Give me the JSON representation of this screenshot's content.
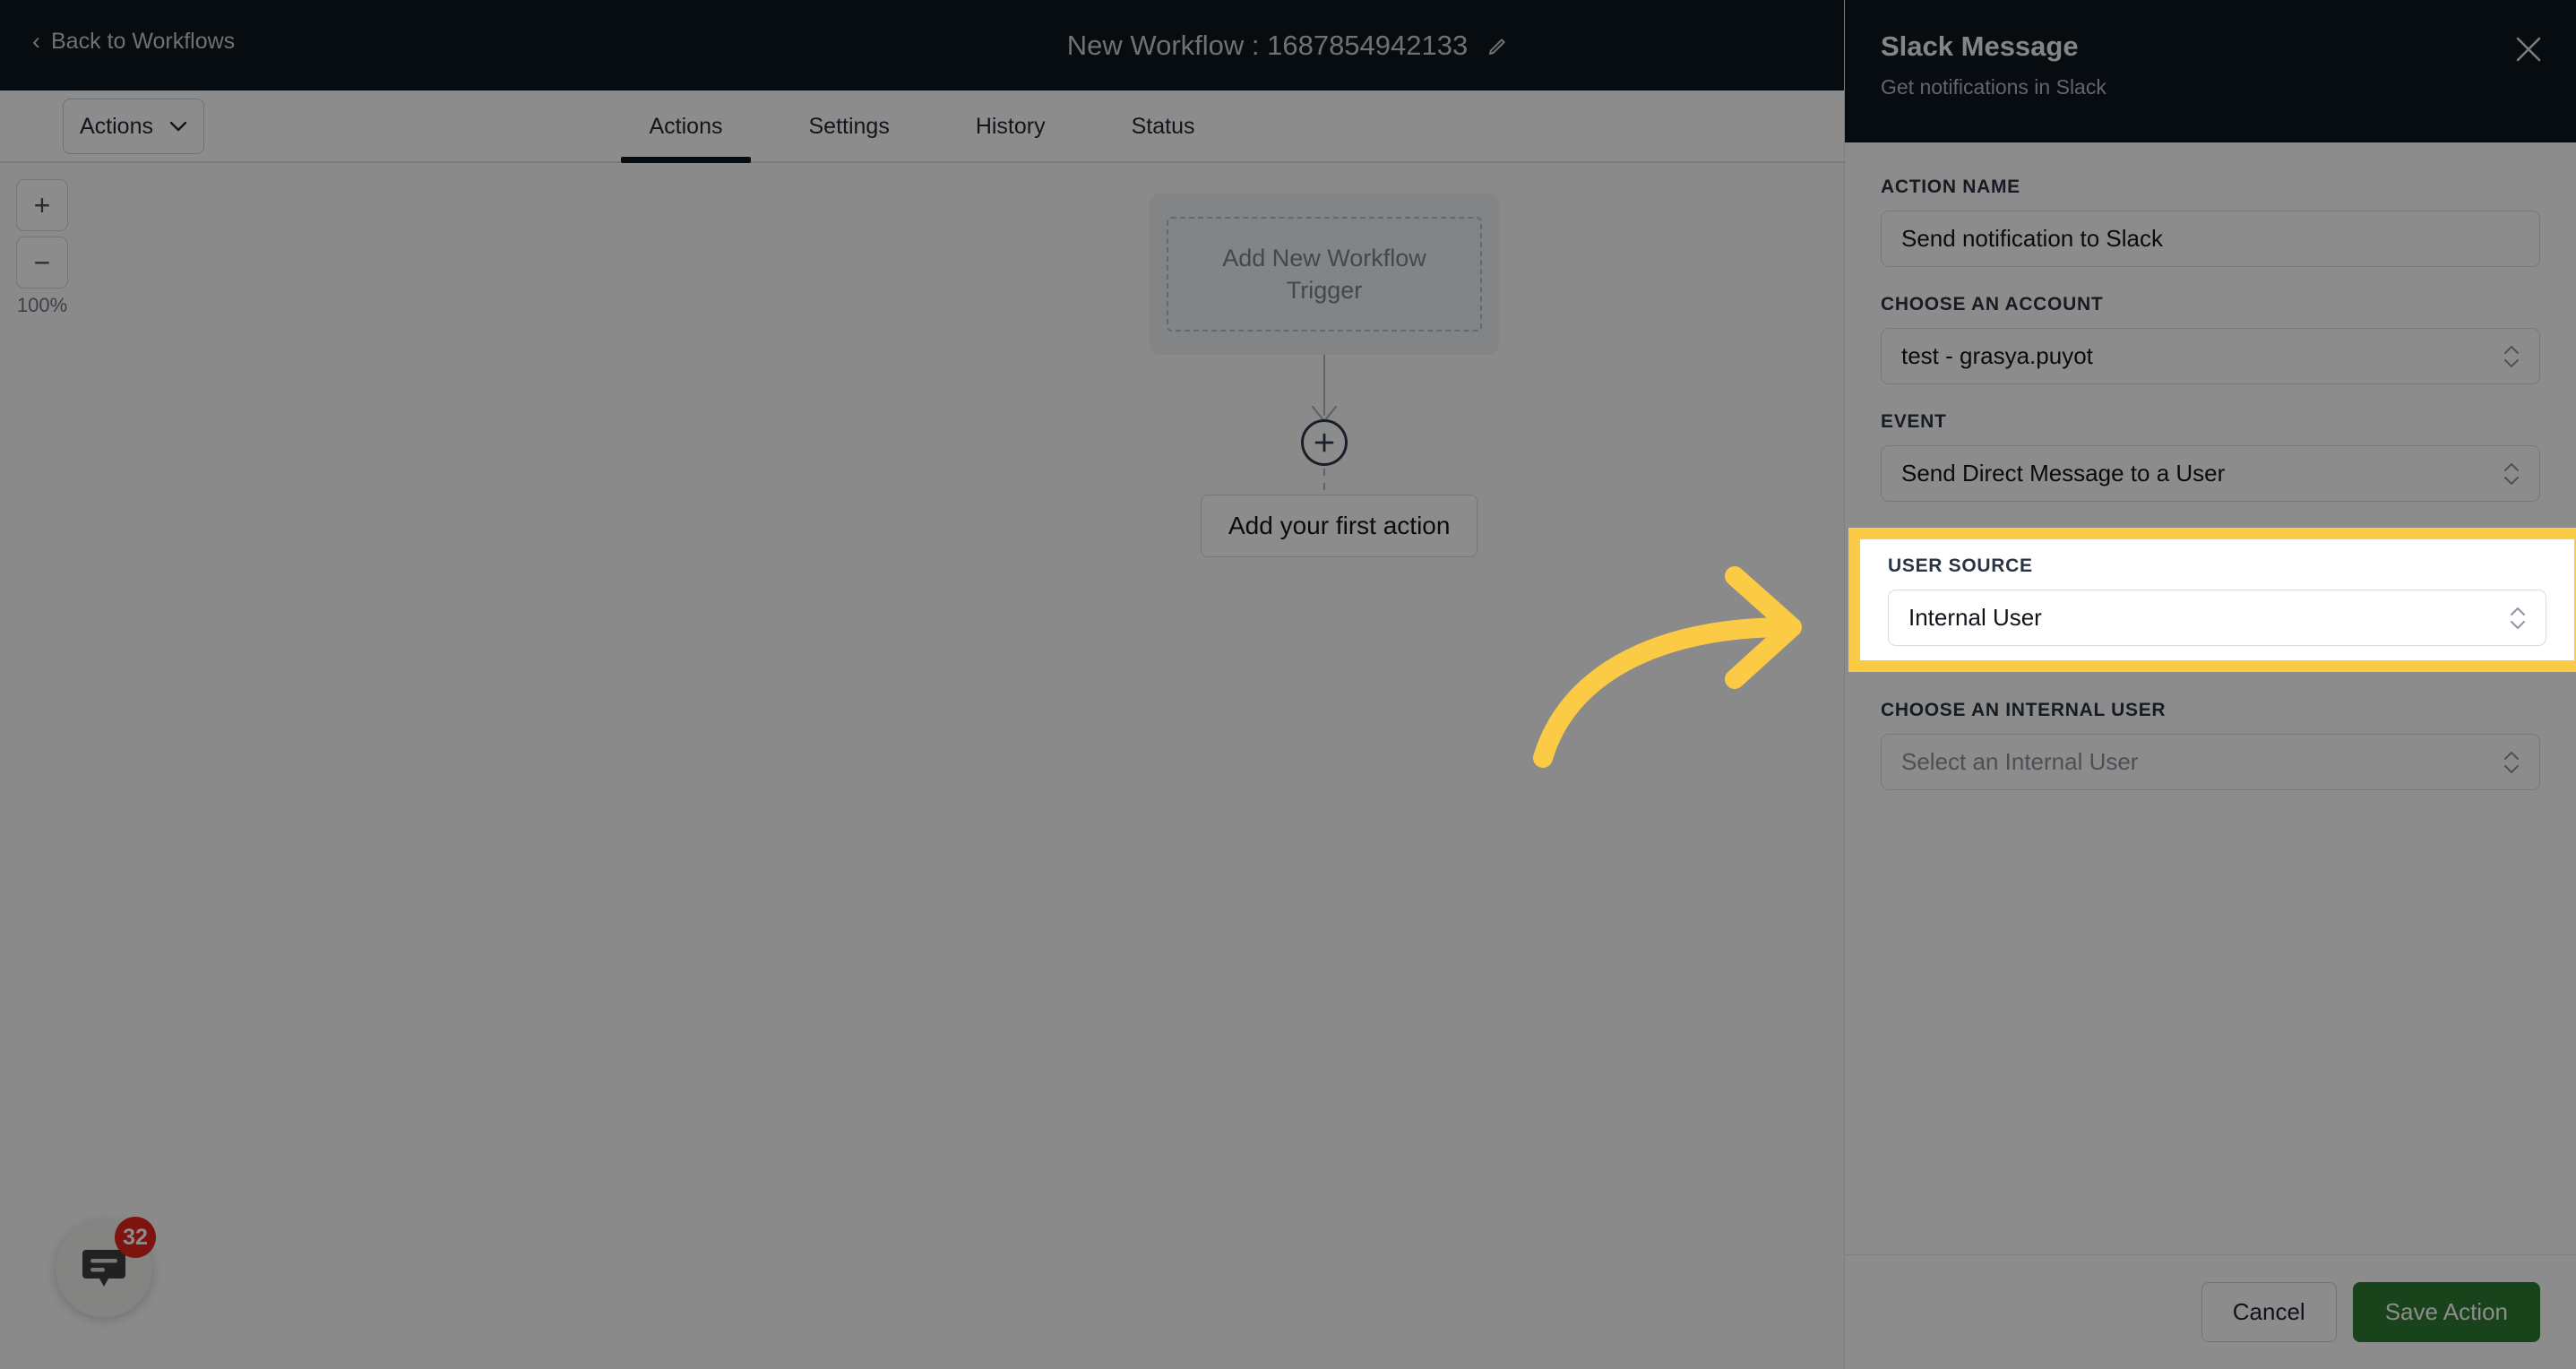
{
  "topbar": {
    "back_label": "Back to Workflows",
    "back_icon": "chevron-left-icon",
    "workflow_title": "New Workflow : 1687854942133",
    "edit_icon": "pencil-icon"
  },
  "toolbar": {
    "actions_dropdown_label": "Actions",
    "dropdown_icon": "chevron-down-icon"
  },
  "tabs": [
    {
      "label": "Actions",
      "active": true
    },
    {
      "label": "Settings",
      "active": false
    },
    {
      "label": "History",
      "active": false
    },
    {
      "label": "Status",
      "active": false
    }
  ],
  "canvas": {
    "zoom_in_label": "+",
    "zoom_out_label": "−",
    "zoom_percent": "100%",
    "trigger_placeholder": "Add New Workflow Trigger",
    "add_node_icon": "plus-circle-icon",
    "first_action_label": "Add your first action"
  },
  "chat_widget": {
    "icon": "chat-bubble-icon",
    "badge_count": "32"
  },
  "drawer": {
    "title": "Slack Message",
    "subtitle": "Get notifications in Slack",
    "close_icon": "close-icon",
    "fields": {
      "action_name": {
        "label": "ACTION NAME",
        "value": "Send notification to Slack"
      },
      "account": {
        "label": "CHOOSE AN ACCOUNT",
        "value": "test - grasya.puyot",
        "icon": "stepper-icon"
      },
      "event": {
        "label": "EVENT",
        "value": "Send Direct Message to a User",
        "icon": "stepper-icon"
      },
      "user_source": {
        "label": "USER SOURCE",
        "value": "Internal User",
        "icon": "stepper-icon"
      },
      "internal_user": {
        "label": "CHOOSE AN INTERNAL USER",
        "placeholder": "Select an Internal User",
        "icon": "stepper-icon"
      }
    },
    "footer": {
      "cancel_label": "Cancel",
      "save_label": "Save Action"
    }
  },
  "annotation": {
    "arrow_icon": "curved-arrow-right-icon",
    "highlight_color": "#fbcb45",
    "arrow_color": "#fbcb45"
  },
  "colors": {
    "dark_header": "#0e1720",
    "save_green": "#2f7d32",
    "badge_red": "#e4261d",
    "highlight_yellow": "#fbcb45"
  }
}
